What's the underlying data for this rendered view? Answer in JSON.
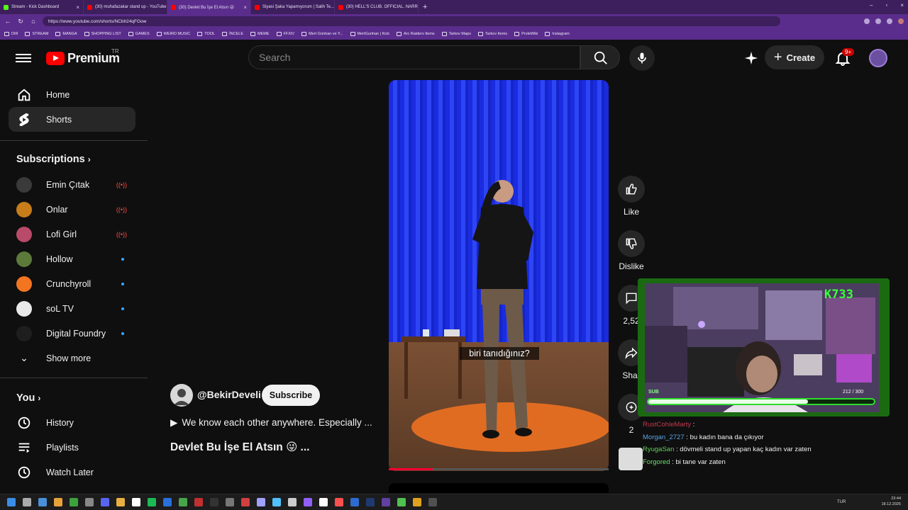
{
  "browser": {
    "tabs": [
      {
        "label": "Stream - Kick Dashboard",
        "color": "#53fc18",
        "active": false
      },
      {
        "label": "(30) muhafazakar stand up - YouTube",
        "color": "#ff0000",
        "active": false
      },
      {
        "label": "(30) Devlet Bu İşe El Atsın 😜",
        "color": "#ff0000",
        "active": true
      },
      {
        "label": "Siyasi Şaka Yapamıyorum | Salih Te...",
        "color": "#ff0000",
        "active": false
      },
      {
        "label": "(30) HELL'S CLUB. OFFICIAL. NARR...",
        "color": "#ff0000",
        "active": false
      }
    ],
    "url": "https://www.youtube.com/shorts/NCbh24qFGow",
    "bookmarks": [
      "DIR",
      "STREAM",
      "MANGA",
      "SHOPPING LIST",
      "GAMES",
      "WEIRD MUSIC",
      "TOOL",
      "İNCELE",
      "MEME",
      "FFXIV",
      "Mert Günhan ve Y...",
      "MertGunhan | Kick",
      "Arc Raiders Items",
      "Tarkov Maps",
      "Tarkov Items",
      "ProleWiki",
      "Instagram"
    ]
  },
  "header": {
    "logo_text": "Premium",
    "country": "TR",
    "search_placeholder": "Search",
    "create_label": "Create",
    "notif_badge": "9+"
  },
  "sidebar": {
    "home": "Home",
    "shorts": "Shorts",
    "subscriptions_title": "Subscriptions",
    "subs": [
      {
        "name": "Emin Çıtak",
        "status": "live",
        "color": "#3a3a3a"
      },
      {
        "name": "Onlar",
        "status": "live",
        "color": "#c77d1a"
      },
      {
        "name": "Lofi Girl",
        "status": "live",
        "color": "#b84a6a"
      },
      {
        "name": "Hollow",
        "status": "new",
        "color": "#5c7a3a"
      },
      {
        "name": "Crunchyroll",
        "status": "new",
        "color": "#f47521"
      },
      {
        "name": "soL TV",
        "status": "new",
        "color": "#e8e8e8"
      },
      {
        "name": "Digital Foundry",
        "status": "new",
        "color": "#1e1e1e"
      }
    ],
    "show_more": "Show more",
    "you_title": "You",
    "you_items": [
      "History",
      "Playlists",
      "Watch Later"
    ]
  },
  "video": {
    "caption": "biri tanıdığınız?",
    "progress": 0.2,
    "channel": "@BekirDeveli",
    "subscribe": "Subscribe",
    "description": "We know each other anywhere. Especially ...",
    "title": "Devlet Bu İşe El Atsın 😜 ..."
  },
  "actions": {
    "like": "Like",
    "dislike": "Dislike",
    "comments": "2,52",
    "share": "Shar",
    "remix": "2"
  },
  "overlay": {
    "kick_count": "K733",
    "sub_label": "SUB",
    "sub_progress_text": "212 / 300",
    "sub_progress": 0.7067,
    "chat": [
      {
        "user": "RustCohleMarty",
        "msg": "",
        "cls": "u1"
      },
      {
        "user": "Morgan_2727",
        "msg": "bu kadın bana da çıkıyor",
        "cls": "u2"
      },
      {
        "user": "RyugaSan",
        "msg": "dövmeli stand up yapan kaç kadın var zaten",
        "cls": "u3"
      },
      {
        "user": "Forgored",
        "msg": "bi tane var zaten",
        "cls": "u4"
      }
    ]
  },
  "taskbar": {
    "lang": "TUR",
    "time": "23:44",
    "date": "18.12.2025"
  }
}
